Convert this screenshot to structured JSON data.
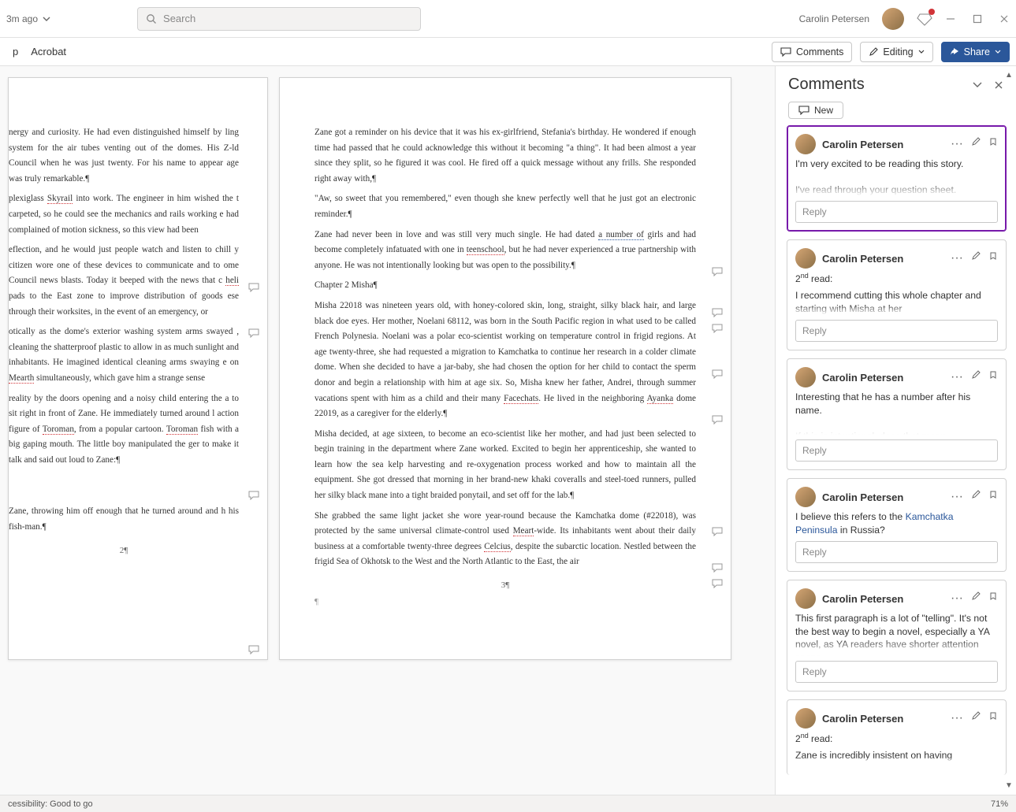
{
  "titlebar": {
    "autosave_label": "3m ago",
    "search_placeholder": "Search",
    "username": "Carolin Petersen"
  },
  "ribbon": {
    "tab_help": "p",
    "tab_acrobat": "Acrobat",
    "comments_btn": "Comments",
    "editing_btn": "Editing",
    "share_btn": "Share"
  },
  "document": {
    "left_page": {
      "paragraphs": [
        "nergy and curiosity. He had even distinguished himself by ling system for the air tubes venting out of the domes. His Z-ld Council when he was just twenty. For his name to appear age was truly remarkable.¶",
        "plexiglass Skyrail into work. The engineer in him wished the t carpeted, so he could see the mechanics and rails working e had complained of motion sickness, so this view had been",
        "eflection, and he would just people watch and listen to chill y citizen wore one of these devices to communicate and to ome Council news blasts. Today it beeped with the news that c heli pads to the East zone to improve distribution of goods ese through their worksites, in the event of an emergency, or",
        "otically as the dome's exterior washing system arms swayed , cleaning the shatterproof plastic to allow in as much sunlight and inhabitants. He imagined identical cleaning arms swaying e on Mearth simultaneously, which gave him a strange sense",
        "reality by the doors opening and a noisy child entering the a to sit right in front of Zane. He immediately turned around l action figure of Toroman, from a popular cartoon. Toroman fish with a big gaping mouth. The little boy manipulated the ger to make it talk and said out loud to Zane:¶",
        "Zane, throwing him off enough that he turned around and h his fish-man.¶"
      ],
      "page_num": "2¶"
    },
    "right_page": {
      "paragraphs": [
        "Zane got a reminder on his device that it was his ex-girlfriend, Stefania's birthday. He wondered if enough time had passed that he could acknowledge this without it becoming \"a thing\". It had been almost a year since they split, so he figured it was cool. He fired off a quick message without any frills. She responded right away with,¶",
        "\"Aw, so sweet that you remembered,\" even though she knew perfectly well that he just got an electronic reminder.¶",
        "Zane had never been in love and was still very much single. He had dated a number of girls and had become completely infatuated with one in teenschool, but he had never experienced a true partnership with anyone. He was not intentionally looking but was open to the possibility.¶",
        "Chapter 2 Misha¶",
        "Misha 22018 was nineteen years old, with honey-colored skin, long, straight, silky black hair, and large black doe eyes. Her mother, Noelani 68112, was born in the South Pacific region in what used to be called French Polynesia. Noelani was a polar eco-scientist working on temperature control in frigid regions. At age twenty-three, she had requested a migration to Kamchatka to continue her research in a colder climate dome. When she decided to have a jar-baby, she had chosen the option for her child to contact the sperm donor and begin a relationship with him at age six. So, Misha knew her father, Andrei, through summer vacations spent with him as a child and their many Facechats. He lived in the neighboring Ayanka dome 22019, as a caregiver for the elderly.¶",
        "Misha decided, at age sixteen, to become an eco-scientist like her mother, and had just been selected to begin training in the department where Zane worked. Excited to begin her apprenticeship, she wanted to learn how the sea kelp harvesting and re-oxygenation process worked and how to maintain all the equipment. She got dressed that morning in her brand-new khaki coveralls and steel-toed runners, pulled her silky black mane into a tight braided ponytail, and set off for the lab.¶",
        "She grabbed the same light jacket she wore year-round because the Kamchatka dome (#22018), was protected by the same universal climate-control used Meart-wide. Its inhabitants went about their daily business at a comfortable twenty-three degrees Celcius, despite the subarctic location. Nestled between the frigid Sea of Okhotsk to the West and the North Atlantic to the East, the air"
      ],
      "page_num": "3¶",
      "end_mark": "¶"
    }
  },
  "comments_pane": {
    "title": "Comments",
    "new_label": "New",
    "reply_placeholder": "Reply",
    "comments": [
      {
        "author": "Carolin Petersen",
        "body": "I'm very excited to be reading this story.\n\nI've read through your question sheet."
      },
      {
        "author": "Carolin Petersen",
        "pre": "2nd read:",
        "body": "I recommend cutting this whole chapter and starting with Misha at her"
      },
      {
        "author": "Carolin Petersen",
        "body": "Interesting that he has a number after his name.\n\nIf this is intentional, does that mean"
      },
      {
        "author": "Carolin Petersen",
        "body_html": "I believe this refers to the <span class='c-link'>Kamchatka Peninsula</span> in Russia?"
      },
      {
        "author": "Carolin Petersen",
        "body": "This first paragraph is a lot of \"telling\". It's not the best way to begin a novel, especially a YA novel, as YA readers have shorter attention spans."
      },
      {
        "author": "Carolin Petersen",
        "pre": "2nd read:",
        "body": "Zane is incredibly insistent on having"
      }
    ]
  },
  "statusbar": {
    "accessibility": "cessibility: Good to go",
    "zoom": "71%"
  }
}
